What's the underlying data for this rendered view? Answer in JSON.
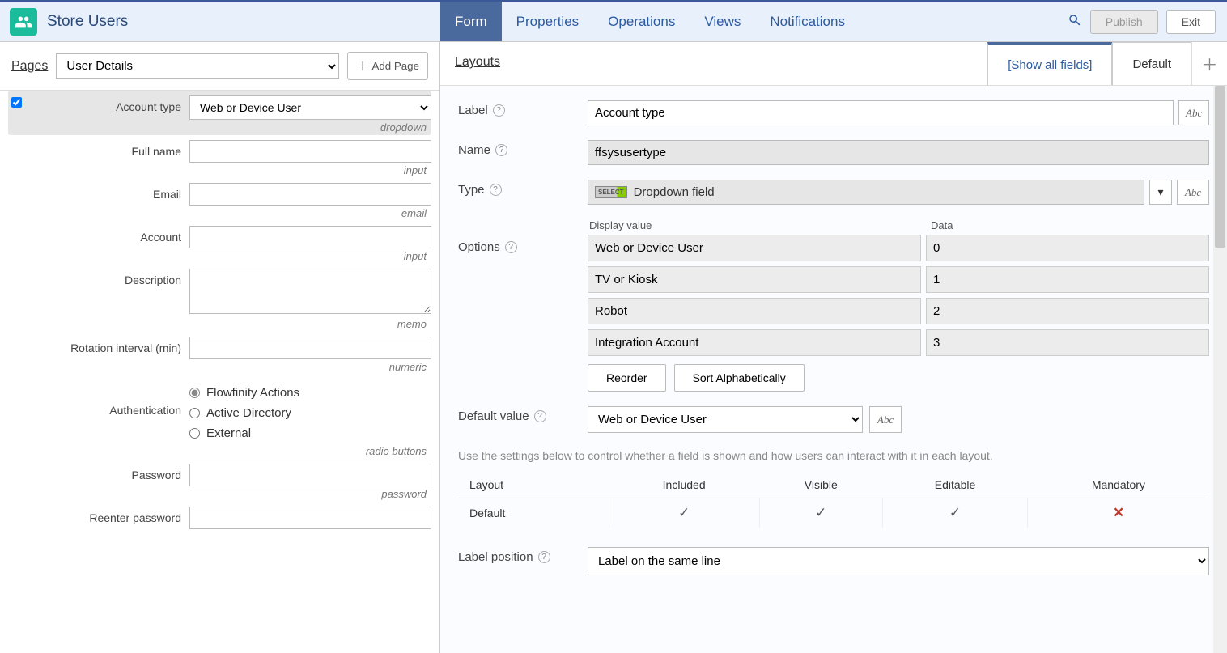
{
  "header": {
    "title": "Store Users",
    "tabs": [
      "Form",
      "Properties",
      "Operations",
      "Views",
      "Notifications"
    ],
    "active_tab": 0,
    "publish": "Publish",
    "exit": "Exit"
  },
  "pages": {
    "label": "Pages",
    "selected": "User Details",
    "add_page": "Add Page"
  },
  "form_fields": [
    {
      "label": "Account type",
      "type_hint": "dropdown",
      "control": "select",
      "value": "Web or Device User",
      "selected": true
    },
    {
      "label": "Full name",
      "type_hint": "input",
      "control": "input"
    },
    {
      "label": "Email",
      "type_hint": "email",
      "control": "input"
    },
    {
      "label": "Account",
      "type_hint": "input",
      "control": "input"
    },
    {
      "label": "Description",
      "type_hint": "memo",
      "control": "textarea"
    },
    {
      "label": "Rotation interval (min)",
      "type_hint": "numeric",
      "control": "input"
    },
    {
      "label": "Authentication",
      "type_hint": "radio buttons",
      "control": "radio",
      "options": [
        "Flowfinity Actions",
        "Active Directory",
        "External"
      ],
      "checked": 0
    },
    {
      "label": "Password",
      "type_hint": "password",
      "control": "input"
    },
    {
      "label": "Reenter password",
      "type_hint": "",
      "control": "input"
    }
  ],
  "layouts": {
    "label": "Layouts",
    "tabs": [
      "[Show all fields]",
      "Default"
    ],
    "active_tab": 0
  },
  "properties": {
    "label_label": "Label",
    "label_value": "Account type",
    "name_label": "Name",
    "name_value": "ffsysusertype",
    "type_label": "Type",
    "type_value": "Dropdown field",
    "type_badge": "SELECT",
    "options_label": "Options",
    "options_headers": {
      "display": "Display value",
      "data": "Data"
    },
    "options": [
      {
        "display": "Web or Device User",
        "data": "0"
      },
      {
        "display": "TV or Kiosk",
        "data": "1"
      },
      {
        "display": "Robot",
        "data": "2"
      },
      {
        "display": "Integration Account",
        "data": "3"
      }
    ],
    "reorder": "Reorder",
    "sort_alpha": "Sort Alphabetically",
    "default_value_label": "Default value",
    "default_value": "Web or Device User",
    "abc": "Abc",
    "hint": "Use the settings below to control whether a field is shown and how users can interact with it in each layout.",
    "layout_table": {
      "headers": [
        "Layout",
        "Included",
        "Visible",
        "Editable",
        "Mandatory"
      ],
      "rows": [
        {
          "name": "Default",
          "included": true,
          "visible": true,
          "editable": true,
          "mandatory": false
        }
      ]
    },
    "label_position_label": "Label position",
    "label_position_value": "Label on the same line"
  }
}
